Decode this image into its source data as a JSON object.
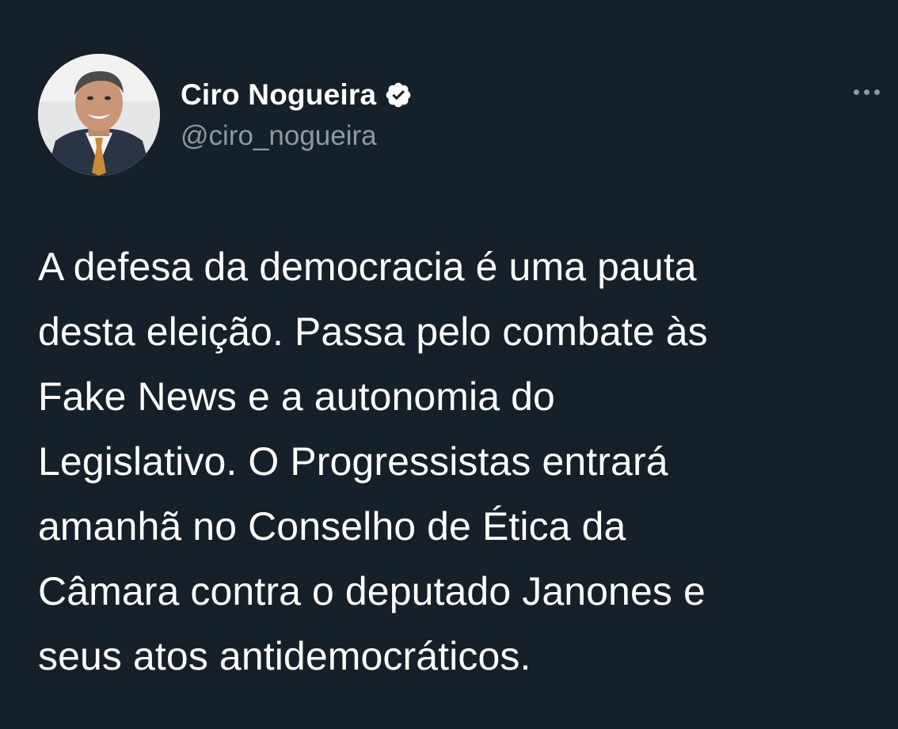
{
  "tweet": {
    "author": {
      "display_name": "Ciro Nogueira",
      "handle": "@ciro_nogueira",
      "verified": true,
      "verified_icon": "verified-badge-icon"
    },
    "more_icon": "more-options-icon",
    "text": "A defesa da democracia é uma pauta\ndesta eleição. Passa pelo combate às\nFake News e a autonomia do\nLegislativo. O Progressistas entrará\namanhã no Conselho de Ética da\nCâmara contra o deputado Janones e\nseus atos antidemocráticos."
  },
  "colors": {
    "background": "#15202b",
    "primary_text": "#ffffff",
    "secondary_text": "#8b98a5"
  }
}
